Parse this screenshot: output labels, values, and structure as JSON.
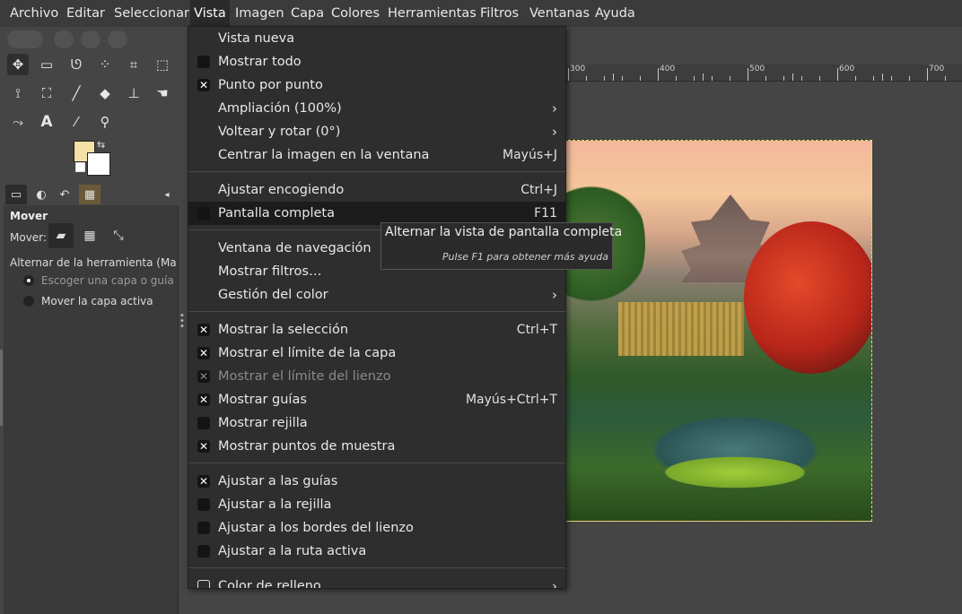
{
  "menubar": {
    "items": [
      "Archivo",
      "Editar",
      "Seleccionar",
      "Vista",
      "Imagen",
      "Capa",
      "Colores",
      "Herramientas",
      "Filtros",
      "Ventanas",
      "Ayuda"
    ],
    "active": "Vista"
  },
  "toolbox": {
    "tools": [
      "move-tool",
      "rect-select-tool",
      "lasso-tool",
      "fuzzy-select-tool",
      "crop-tool",
      "unified-transform-tool",
      "warp-transform-tool",
      "bucket-fill-tool",
      "paintbrush-tool",
      "eraser-tool",
      "clone-tool",
      "smudge-tool",
      "paths-tool",
      "text-tool",
      "color-picker-tool",
      "zoom-tool"
    ],
    "fg_color": "#f5e0a6",
    "bg_color": "#ffffff"
  },
  "tool_options": {
    "title": "Mover",
    "mover_label": "Mover:",
    "toggle_label": "Alternar de la herramienta  (Mayú",
    "option1": "Escoger una capa o guía",
    "option2": "Mover la capa activa"
  },
  "ruler": {
    "labels": [
      "300",
      "400",
      "500",
      "600",
      "700"
    ]
  },
  "view_menu": {
    "items": [
      {
        "label": "Vista nueva"
      },
      {
        "label": "Mostrar todo",
        "check": "off"
      },
      {
        "label": "Punto por punto",
        "check": "on"
      },
      {
        "label": "Ampliación (100%)",
        "submenu": true
      },
      {
        "label": "Voltear  y rotar (0°)",
        "submenu": true
      },
      {
        "label": "Centrar la imagen en la ventana",
        "shortcut": "Mayús+J"
      },
      {
        "label": "Ajustar encogiendo",
        "shortcut": "Ctrl+J"
      },
      {
        "label": "Pantalla completa",
        "shortcut": "F11",
        "check": "off",
        "highlighted": true
      },
      {
        "label": "Ventana de navegación"
      },
      {
        "label": "Mostrar filtros…"
      },
      {
        "label": "Gestión del color",
        "submenu": true
      },
      {
        "label": "Mostrar la selección",
        "shortcut": "Ctrl+T",
        "check": "on"
      },
      {
        "label": "Mostrar el límite de la capa",
        "check": "on"
      },
      {
        "label": "Mostrar el límite del lienzo",
        "check": "on",
        "disabled": true
      },
      {
        "label": "Mostrar guías",
        "shortcut": "Mayús+Ctrl+T",
        "check": "on"
      },
      {
        "label": "Mostrar rejilla",
        "check": "off"
      },
      {
        "label": "Mostrar puntos de muestra",
        "check": "on"
      },
      {
        "label": "Ajustar a las guías",
        "check": "on"
      },
      {
        "label": "Ajustar a la rejilla",
        "check": "off"
      },
      {
        "label": "Ajustar a los bordes del lienzo",
        "check": "off"
      },
      {
        "label": "Ajustar a la ruta activa",
        "check": "off"
      },
      {
        "label": "Color de relleno",
        "submenu": true
      }
    ]
  },
  "tooltip": {
    "title": "Alternar la vista de pantalla completa",
    "help": "Pulse F1 para obtener más ayuda"
  }
}
